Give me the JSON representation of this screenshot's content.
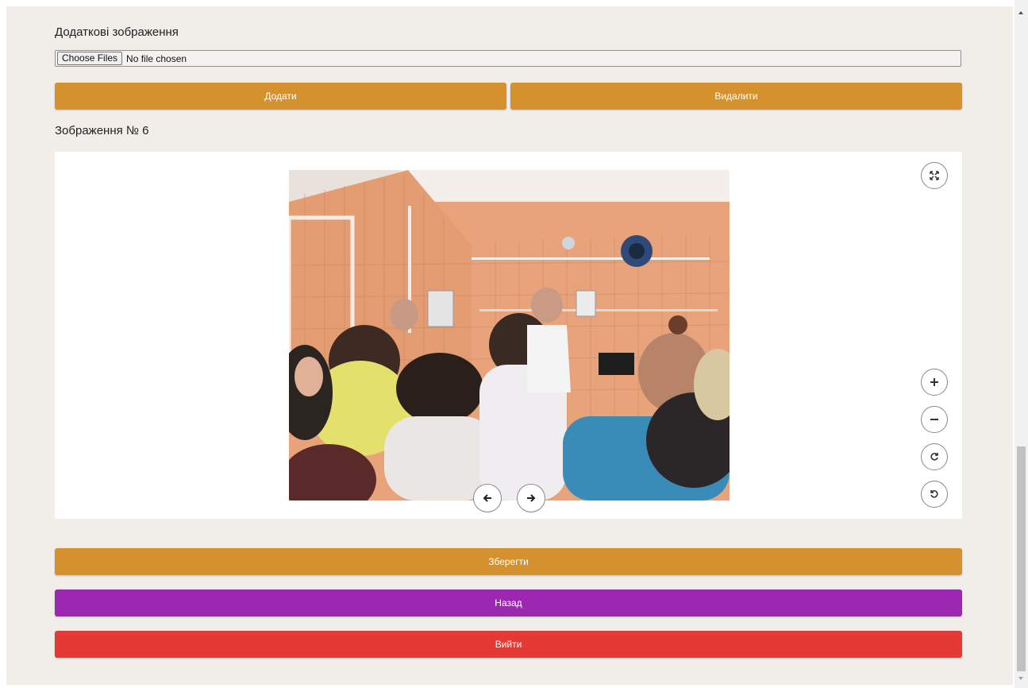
{
  "extra_images": {
    "label": "Додаткові зображення",
    "choose_files": "Choose Files",
    "file_status": "No file chosen"
  },
  "actions": {
    "add": "Додати",
    "delete": "Видалити"
  },
  "image_viewer": {
    "title": "Зображення № 6",
    "icons": [
      "fullscreen-icon",
      "zoom-in-icon",
      "zoom-out-icon",
      "rotate-right-icon",
      "rotate-left-icon",
      "arrow-left-icon",
      "arrow-right-icon"
    ]
  },
  "footer_buttons": {
    "save": "Зберегти",
    "back": "Назад",
    "exit": "Вийти"
  },
  "colors": {
    "page_bg": "#f1eeea",
    "orange": "#d4912e",
    "purple": "#9c27b0",
    "red": "#e53935"
  }
}
